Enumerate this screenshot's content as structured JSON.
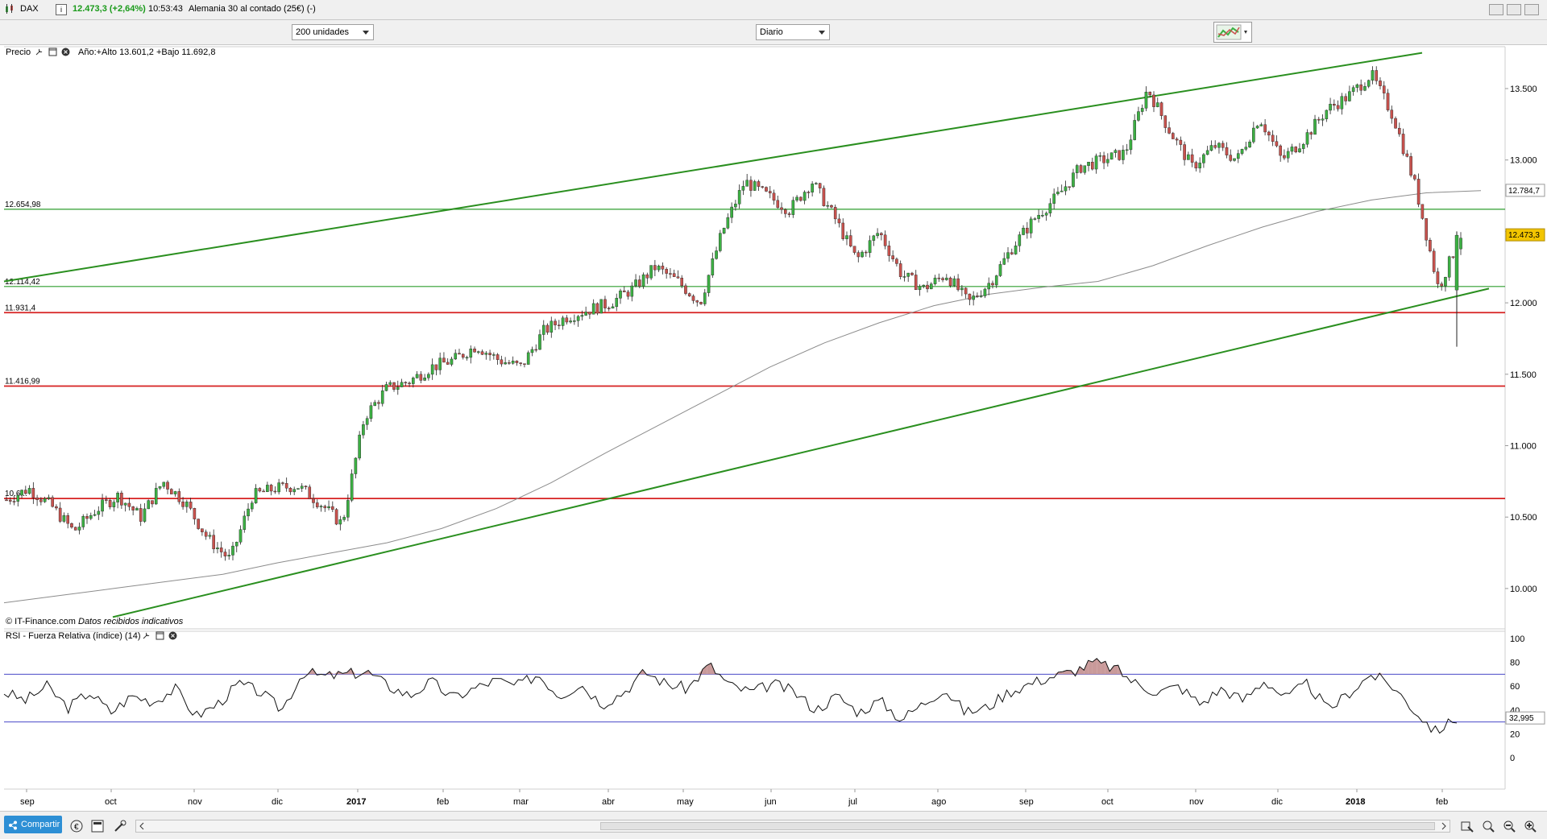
{
  "window": {
    "symbol": "DAX",
    "price_change": "12.473,3 (+2,64%)",
    "time": "10:53:43",
    "instrument": "Alemania 30 al contado (25€) (-)"
  },
  "toolbar": {
    "units_select": "200 unidades",
    "period_select": "Diario"
  },
  "price_panel": {
    "label": "Precio",
    "stats": "Año:+Alto 13.601,2 +Bajo 11.692,8",
    "source": "© IT-Finance.com",
    "source_note": "Datos recibidos indicativos",
    "last_price": "12.473,3",
    "ma_value": "12.784,7",
    "hline_labels": [
      "12.654,98",
      "12.114,42",
      "11.931,4",
      "11.416,99",
      "10.6..."
    ]
  },
  "rsi_panel": {
    "label": "RSI - Fuerza Relativa (índice) (14)",
    "last_value": "32,995"
  },
  "bottom": {
    "share_label": "Compartir"
  },
  "colors": {
    "up_candle": "#3cb043",
    "down_candle": "#c8524e",
    "support_green": "#2e9e2e",
    "trend_green": "#2a8f1f",
    "resistance_red": "#d62020",
    "ma_line": "#8c8c8c",
    "last_price_bg": "#f2c500",
    "rsi_band": "#4a4ac8",
    "rsi_fill": "#c99a9a"
  },
  "chart_data": [
    {
      "type": "candlestick",
      "title": "DAX",
      "x_ticks": [
        "sep",
        "oct",
        "nov",
        "dic",
        "2017",
        "feb",
        "mar",
        "abr",
        "may",
        "jun",
        "jul",
        "ago",
        "sep",
        "oct",
        "nov",
        "dic",
        "2018",
        "feb"
      ],
      "y_ticks": [
        "13.500",
        "13.000",
        "12.500",
        "12.000",
        "11.500",
        "11.000",
        "10.500",
        "10.000"
      ],
      "ylim": [
        9750,
        13800
      ],
      "approx_close_series": [
        10620,
        10700,
        10580,
        10400,
        10550,
        10650,
        10500,
        10750,
        10600,
        10350,
        10200,
        10650,
        10700,
        10720,
        10600,
        10450,
        11200,
        11400,
        11450,
        11550,
        11600,
        11700,
        11600,
        11550,
        11800,
        11900,
        11950,
        12000,
        12100,
        12250,
        12150,
        12000,
        12500,
        12850,
        12750,
        12650,
        12850,
        12600,
        12300,
        12500,
        12200,
        12100,
        12200,
        12000,
        12150,
        12400,
        12600,
        12750,
        12950,
        13000,
        13050,
        13500,
        13200,
        12950,
        13100,
        13000,
        13300,
        13000,
        13150,
        13350,
        13450,
        13600,
        13300,
        12800,
        12100,
        12473
      ],
      "ma_200_series": [
        9900,
        9950,
        10000,
        10050,
        10100,
        10180,
        10250,
        10320,
        10420,
        10560,
        10740,
        10950,
        11150,
        11350,
        11550,
        11720,
        11860,
        11980,
        12060,
        12110,
        12150,
        12260,
        12400,
        12530,
        12640,
        12720,
        12770,
        12785
      ],
      "resistance_levels": [
        12654.98,
        12114.42,
        11931.4,
        11416.99,
        10630
      ],
      "channel_upper": [
        {
          "x": "sep",
          "y": 12150
        },
        {
          "x": "feb",
          "y": 13750
        }
      ],
      "channel_lower": [
        {
          "x": "oct",
          "y": 9800
        },
        {
          "x": "feb",
          "y": 12100
        }
      ],
      "last_price": 12473.3,
      "ma_last": 12784.7
    },
    {
      "type": "line",
      "title": "RSI - Fuerza Relativa (índice) (14)",
      "y_ticks": [
        "100",
        "80",
        "60",
        "40",
        "20",
        "0"
      ],
      "ylim": [
        0,
        100
      ],
      "bands": [
        70,
        30
      ],
      "approx_values": [
        55,
        48,
        60,
        42,
        55,
        38,
        52,
        47,
        58,
        35,
        45,
        62,
        55,
        40,
        72,
        68,
        70,
        72,
        60,
        52,
        64,
        50,
        58,
        65,
        60,
        70,
        52,
        62,
        45,
        55,
        72,
        62,
        58,
        78,
        60,
        55,
        62,
        55,
        40,
        52,
        38,
        48,
        32,
        45,
        58,
        38,
        42,
        55,
        62,
        68,
        72,
        80,
        75,
        62,
        55,
        60,
        45,
        58,
        48,
        65,
        50,
        62,
        40,
        55,
        70,
        60,
        40,
        22,
        33
      ]
    }
  ]
}
